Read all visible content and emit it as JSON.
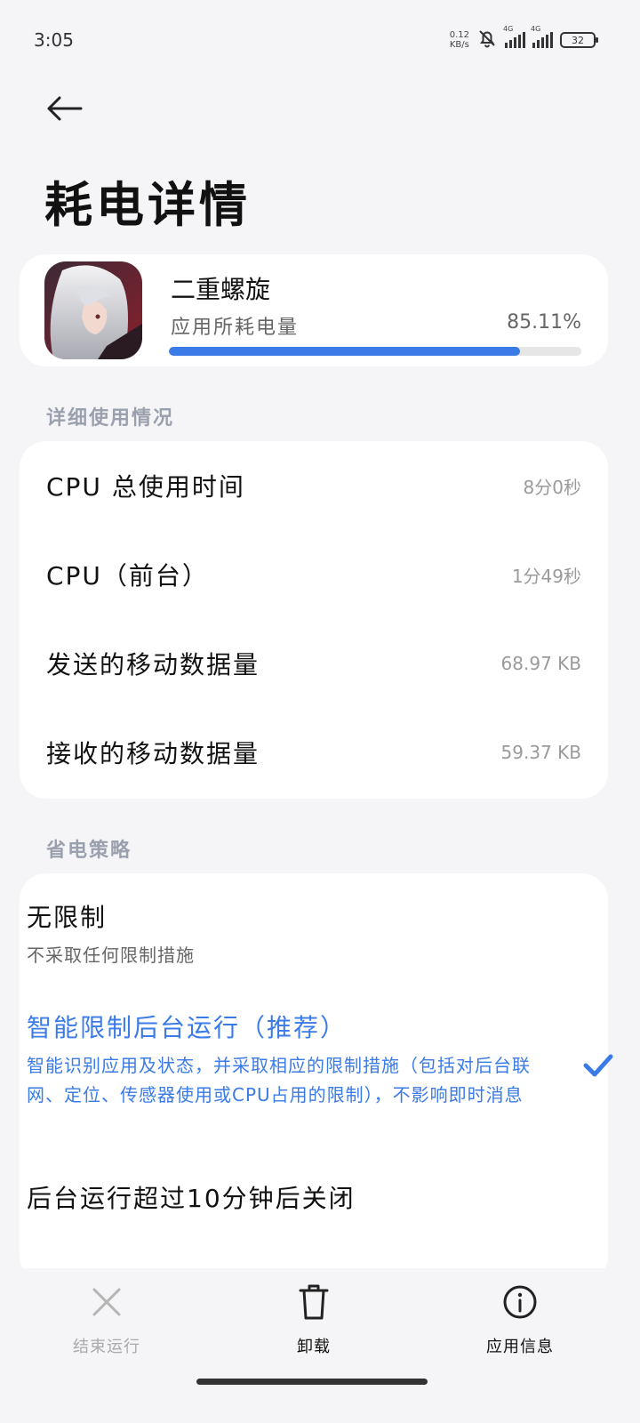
{
  "status": {
    "time": "3:05",
    "net_speed_value": "0.12",
    "net_speed_unit": "KB/s",
    "sim1_label": "4G",
    "sim2_label": "4G",
    "battery": "32"
  },
  "header": {
    "title": "耗电详情"
  },
  "app": {
    "name": "二重螺旋",
    "usage_label": "应用所耗电量",
    "usage_pct": "85.11%",
    "usage_fraction": 0.8511
  },
  "details": {
    "section_title": "详细使用情况",
    "rows": [
      {
        "label": "CPU 总使用时间",
        "value": "8分0秒"
      },
      {
        "label": "CPU（前台）",
        "value": "1分49秒"
      },
      {
        "label": "发送的移动数据量",
        "value": "68.97 KB"
      },
      {
        "label": "接收的移动数据量",
        "value": "59.37 KB"
      }
    ]
  },
  "policy": {
    "section_title": "省电策略",
    "options": [
      {
        "title": "无限制",
        "desc": "不采取任何限制措施",
        "selected": false
      },
      {
        "title": "智能限制后台运行（推荐）",
        "desc": "智能识别应用及状态，并采取相应的限制措施（包括对后台联网、定位、传感器使用或CPU占用的限制），不影响即时消息",
        "selected": true
      },
      {
        "title": "后台运行超过10分钟后关闭",
        "desc": "",
        "selected": false
      }
    ]
  },
  "actions": {
    "stop": "结束运行",
    "uninstall": "卸载",
    "info": "应用信息"
  },
  "colors": {
    "accent": "#3a7be7",
    "background": "#f5f5f7",
    "card": "#ffffff"
  }
}
